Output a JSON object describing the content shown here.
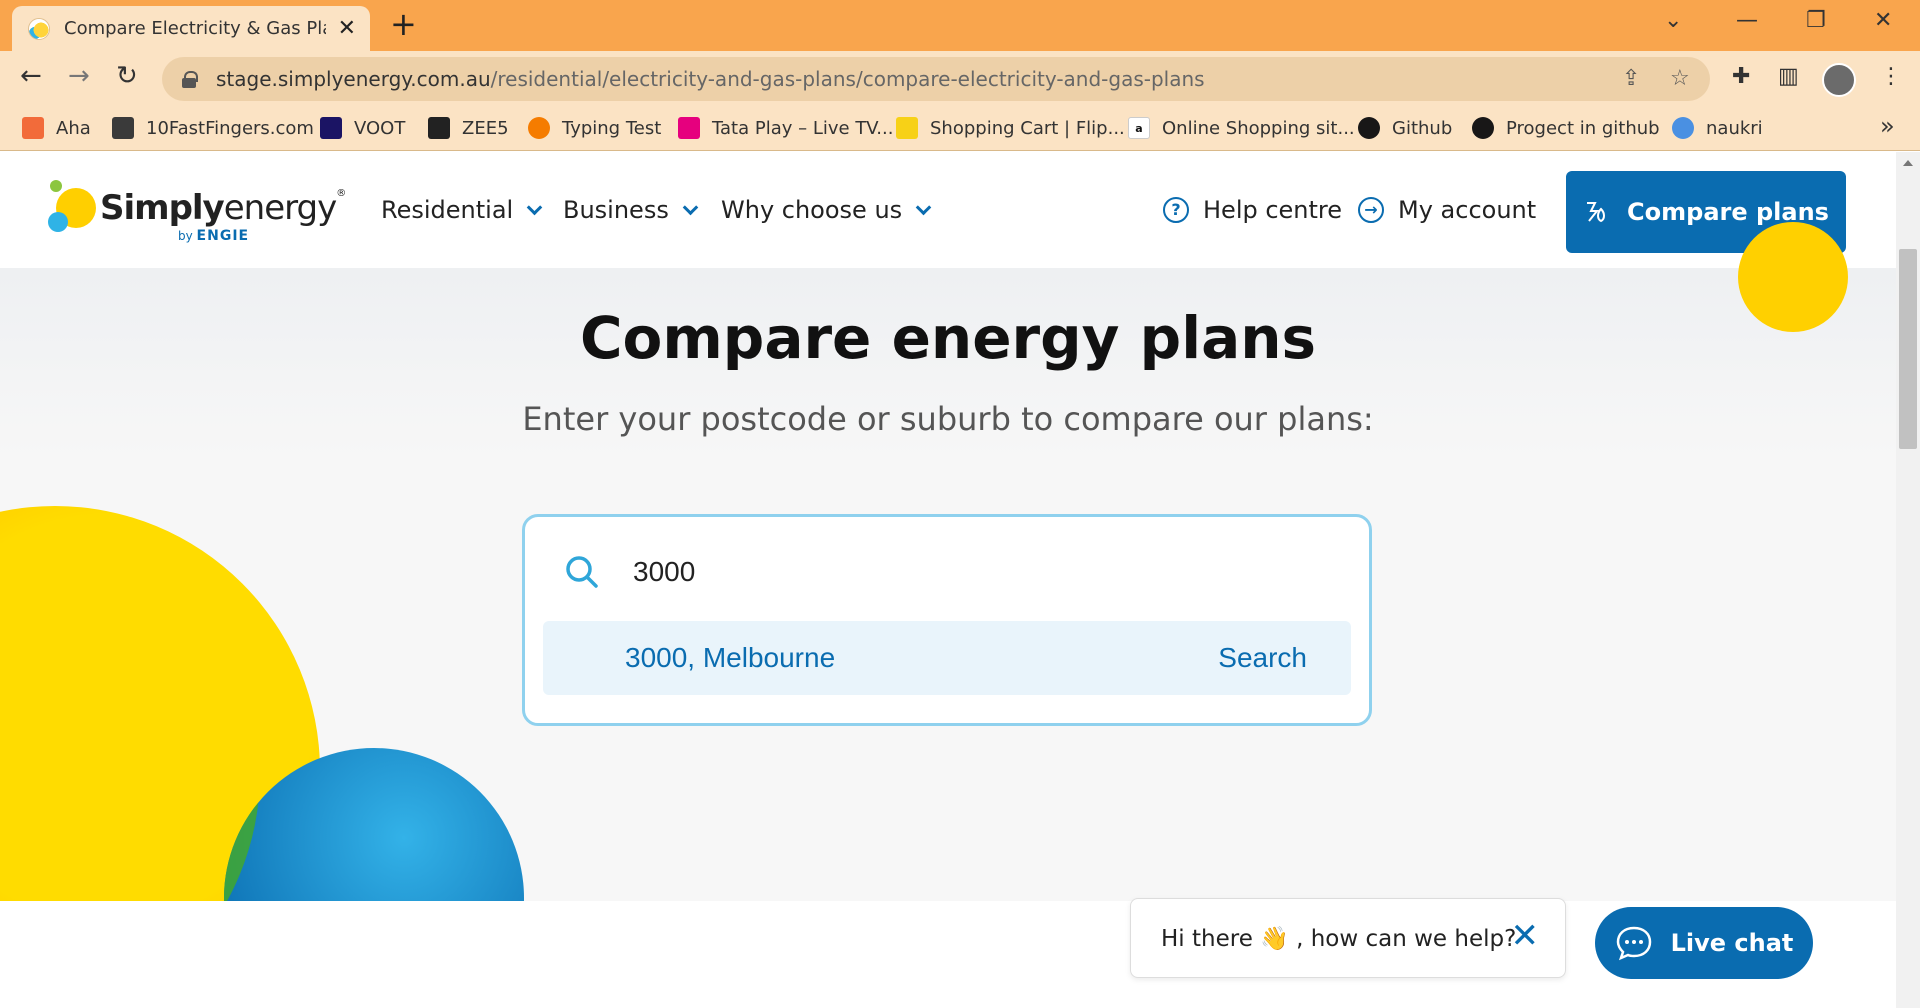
{
  "browser": {
    "tab_title": "Compare Electricity & Gas Plans |",
    "tab_close": "✕",
    "new_tab": "+",
    "url_domain": "stage.simplyenergy.com.au",
    "url_path": "/residential/electricity-and-gas-plans/compare-electricity-and-gas-plans",
    "bookmarks": [
      {
        "label": "Aha",
        "color": "#f26b3a"
      },
      {
        "label": "10FastFingers.com",
        "color": "#3a3a3a"
      },
      {
        "label": "VOOT",
        "color": "#1b1464"
      },
      {
        "label": "ZEE5",
        "color": "#222222"
      },
      {
        "label": "Typing Test",
        "color": "#f57c00"
      },
      {
        "label": "Tata Play – Live TV...",
        "color": "#e6007e"
      },
      {
        "label": "Shopping Cart | Flip...",
        "color": "#f7d117"
      },
      {
        "label": "Online Shopping sit...",
        "color": "#111111"
      },
      {
        "label": "Github",
        "color": "#181717"
      },
      {
        "label": "Progect in github",
        "color": "#181717"
      },
      {
        "label": "naukri",
        "color": "#4a90e2"
      }
    ],
    "bookmarks_more": "»"
  },
  "header": {
    "logo_text_simply": "Simply",
    "logo_text_energy": "energy",
    "logo_by": "by",
    "logo_engie": "ENGIE",
    "nav": [
      "Residential",
      "Business",
      "Why choose us"
    ],
    "help_label": "Help centre",
    "account_label": "My account",
    "compare_label": "Compare plans"
  },
  "hero": {
    "title": "Compare energy plans",
    "subtitle": "Enter your postcode or suburb to compare our plans:",
    "search_value": "3000",
    "suggestion_text": "3000, Melbourne",
    "suggestion_action": "Search"
  },
  "chat": {
    "greeting": "Hi there 👋 , how can we help?",
    "close": "✕",
    "live_chat_label": "Live chat"
  },
  "colors": {
    "brand_blue": "#0a6cb0",
    "brand_yellow": "#ffd000",
    "chrome_orange": "#f9a54d"
  }
}
